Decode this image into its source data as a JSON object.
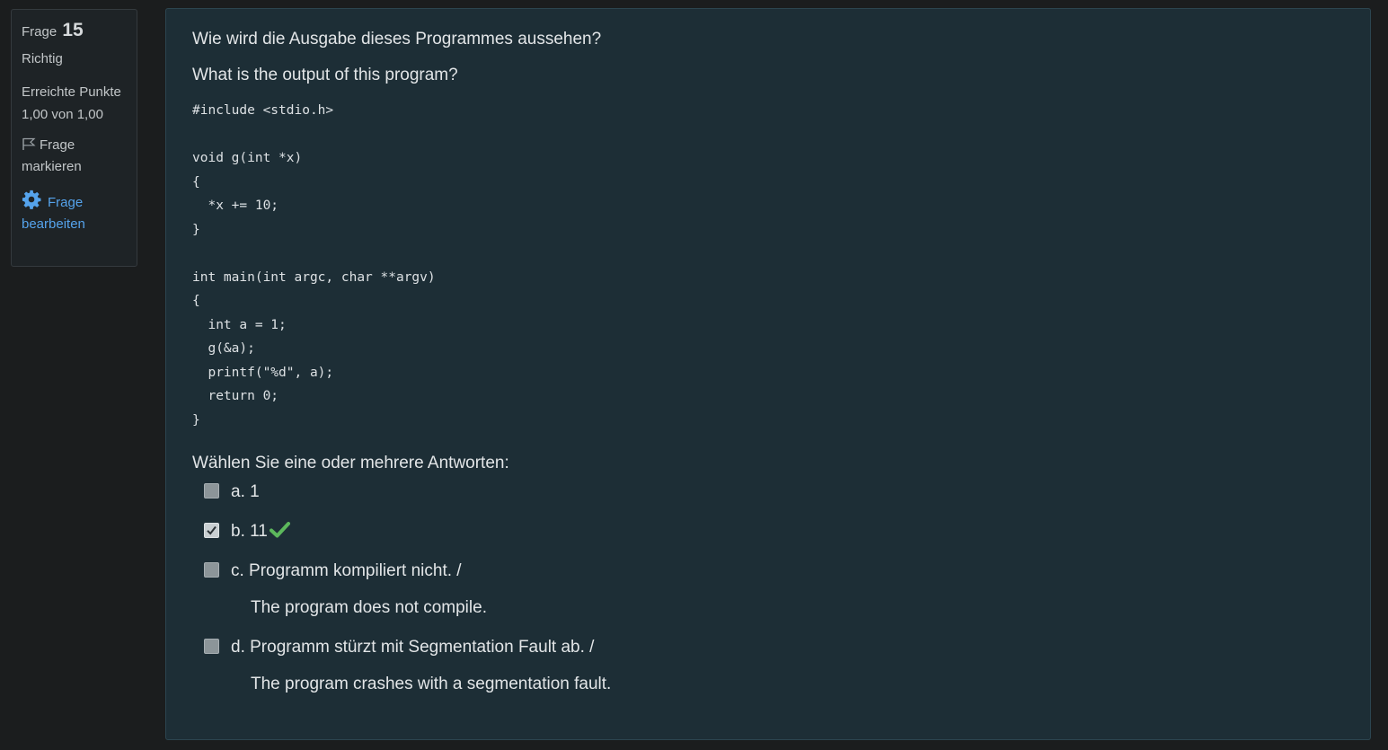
{
  "info": {
    "question_label": "Frage",
    "question_number": "15",
    "state": "Richtig",
    "grade": "Erreichte Punkte 1,00 von 1,00",
    "flag_label": "Frage markieren",
    "edit_label": "Frage bearbeiten"
  },
  "question": {
    "text_de": "Wie wird die Ausgabe dieses Programmes aussehen?",
    "text_en": "What is the output of this program?",
    "code": "#include <stdio.h>\n\nvoid g(int *x)\n{\n  *x += 10;\n}\n\nint main(int argc, char **argv)\n{\n  int a = 1;\n  g(&a);\n  printf(\"%d\", a);\n  return 0;\n}",
    "prompt": "Wählen Sie eine oder mehrere Antworten:"
  },
  "answers": [
    {
      "text": "a. 1",
      "text2": "",
      "checked": false,
      "correct": false
    },
    {
      "text": "b. 11",
      "text2": "",
      "checked": true,
      "correct": true
    },
    {
      "text": "c. Programm kompiliert nicht. /",
      "text2": "The program does not compile.",
      "checked": false,
      "correct": false
    },
    {
      "text": "d. Programm stürzt mit Segmentation Fault ab. /",
      "text2": "The program crashes with a segmentation fault.",
      "checked": false,
      "correct": false
    }
  ],
  "colors": {
    "page_bg": "#1b1d1e",
    "panel_bg": "#1d2e36",
    "link": "#55a3ec",
    "correct_tick": "#5cb85c"
  }
}
